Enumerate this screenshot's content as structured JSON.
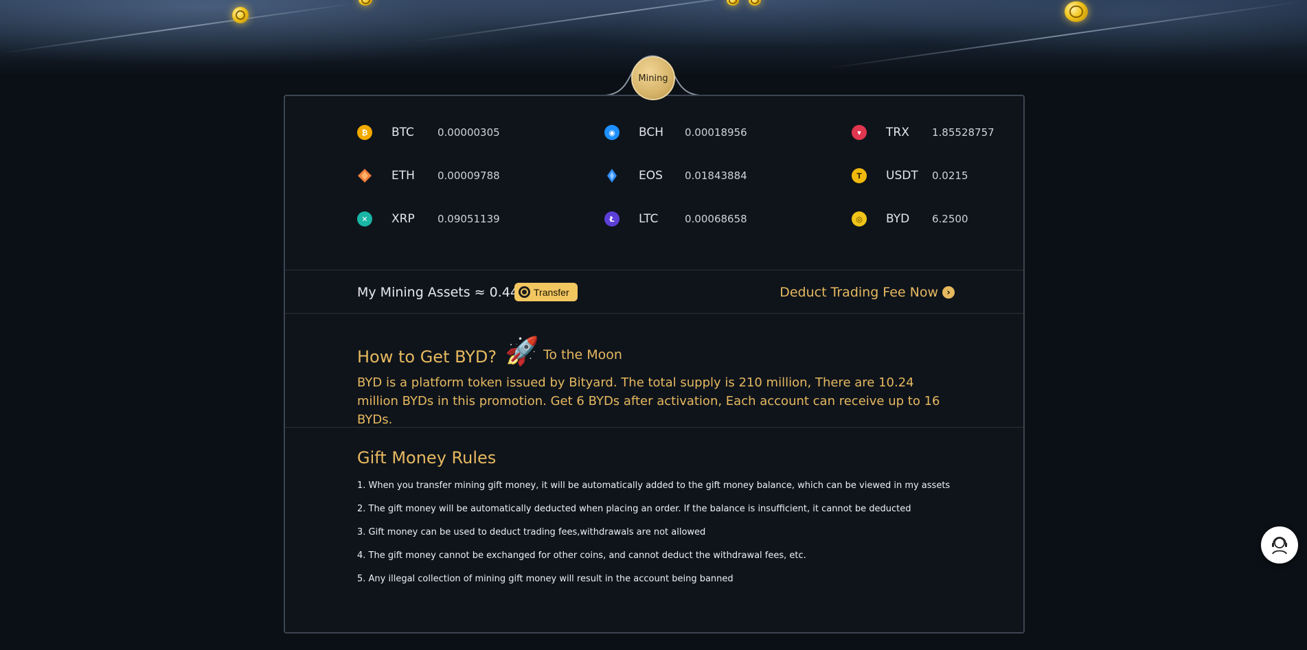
{
  "header": {
    "badge_label": "Mining"
  },
  "coins": [
    {
      "symbol": "BTC",
      "value": "0.00000305",
      "icon": "btc-icon",
      "color": "#f2a900"
    },
    {
      "symbol": "BCH",
      "value": "0.00018956",
      "icon": "bch-icon",
      "color": "#1e90ff"
    },
    {
      "symbol": "TRX",
      "value": "1.85528757",
      "icon": "trx-icon",
      "color": "#e0364f"
    },
    {
      "symbol": "ETH",
      "value": "0.00009788",
      "icon": "eth-icon",
      "color": "#f0803c"
    },
    {
      "symbol": "EOS",
      "value": "0.01843884",
      "icon": "eos-icon",
      "color": "#2f8fff"
    },
    {
      "symbol": "USDT",
      "value": "0.0215",
      "icon": "usdt-icon",
      "color": "#f0b90b"
    },
    {
      "symbol": "XRP",
      "value": "0.09051139",
      "icon": "xrp-icon",
      "color": "#19b5a5"
    },
    {
      "symbol": "LTC",
      "value": "0.00068658",
      "icon": "ltc-icon",
      "color": "#5b3fd6"
    },
    {
      "symbol": "BYD",
      "value": "6.2500",
      "icon": "byd-icon",
      "color": "#f0c419"
    }
  ],
  "assets": {
    "label": "My Mining Assets ≈ 0.44",
    "transfer_label": "Transfer",
    "deduct_label": "Deduct Trading Fee Now"
  },
  "howto": {
    "title": "How to Get BYD?",
    "subtitle": "To the Moon",
    "text": "BYD is a platform token issued by Bityard. The total supply is 210 million, There are 10.24 million BYDs in this promotion. Get 6 BYDs after activation, Each account can receive up to 16 BYDs."
  },
  "rules": {
    "title": "Gift Money Rules",
    "items": [
      "1. When you transfer mining gift money, it will be automatically added to the gift money balance, which can be viewed in my assets",
      "2. The gift money will be automatically deducted when placing an order. If the balance is insufficient, it cannot be deducted",
      "3. Gift money can be used to deduct trading fees,withdrawals are not allowed",
      "4. The gift money cannot be exchanged for other coins, and cannot deduct the withdrawal fees, etc.",
      "5. Any illegal collection of mining gift money will result in the account being banned"
    ]
  },
  "colors": {
    "accent": "#e6b95f",
    "button": "#f2c760",
    "panel": "#0f141b"
  }
}
